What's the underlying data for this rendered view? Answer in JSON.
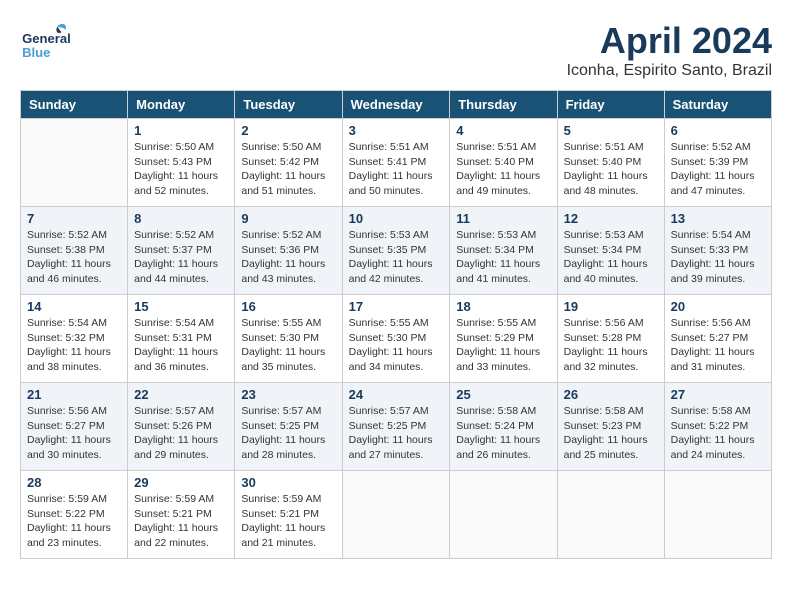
{
  "header": {
    "logo_general": "General",
    "logo_blue": "Blue",
    "month_title": "April 2024",
    "location": "Iconha, Espirito Santo, Brazil"
  },
  "days_of_week": [
    "Sunday",
    "Monday",
    "Tuesday",
    "Wednesday",
    "Thursday",
    "Friday",
    "Saturday"
  ],
  "weeks": [
    [
      {
        "day": "",
        "info": ""
      },
      {
        "day": "1",
        "info": "Sunrise: 5:50 AM\nSunset: 5:43 PM\nDaylight: 11 hours\nand 52 minutes."
      },
      {
        "day": "2",
        "info": "Sunrise: 5:50 AM\nSunset: 5:42 PM\nDaylight: 11 hours\nand 51 minutes."
      },
      {
        "day": "3",
        "info": "Sunrise: 5:51 AM\nSunset: 5:41 PM\nDaylight: 11 hours\nand 50 minutes."
      },
      {
        "day": "4",
        "info": "Sunrise: 5:51 AM\nSunset: 5:40 PM\nDaylight: 11 hours\nand 49 minutes."
      },
      {
        "day": "5",
        "info": "Sunrise: 5:51 AM\nSunset: 5:40 PM\nDaylight: 11 hours\nand 48 minutes."
      },
      {
        "day": "6",
        "info": "Sunrise: 5:52 AM\nSunset: 5:39 PM\nDaylight: 11 hours\nand 47 minutes."
      }
    ],
    [
      {
        "day": "7",
        "info": "Sunrise: 5:52 AM\nSunset: 5:38 PM\nDaylight: 11 hours\nand 46 minutes."
      },
      {
        "day": "8",
        "info": "Sunrise: 5:52 AM\nSunset: 5:37 PM\nDaylight: 11 hours\nand 44 minutes."
      },
      {
        "day": "9",
        "info": "Sunrise: 5:52 AM\nSunset: 5:36 PM\nDaylight: 11 hours\nand 43 minutes."
      },
      {
        "day": "10",
        "info": "Sunrise: 5:53 AM\nSunset: 5:35 PM\nDaylight: 11 hours\nand 42 minutes."
      },
      {
        "day": "11",
        "info": "Sunrise: 5:53 AM\nSunset: 5:34 PM\nDaylight: 11 hours\nand 41 minutes."
      },
      {
        "day": "12",
        "info": "Sunrise: 5:53 AM\nSunset: 5:34 PM\nDaylight: 11 hours\nand 40 minutes."
      },
      {
        "day": "13",
        "info": "Sunrise: 5:54 AM\nSunset: 5:33 PM\nDaylight: 11 hours\nand 39 minutes."
      }
    ],
    [
      {
        "day": "14",
        "info": "Sunrise: 5:54 AM\nSunset: 5:32 PM\nDaylight: 11 hours\nand 38 minutes."
      },
      {
        "day": "15",
        "info": "Sunrise: 5:54 AM\nSunset: 5:31 PM\nDaylight: 11 hours\nand 36 minutes."
      },
      {
        "day": "16",
        "info": "Sunrise: 5:55 AM\nSunset: 5:30 PM\nDaylight: 11 hours\nand 35 minutes."
      },
      {
        "day": "17",
        "info": "Sunrise: 5:55 AM\nSunset: 5:30 PM\nDaylight: 11 hours\nand 34 minutes."
      },
      {
        "day": "18",
        "info": "Sunrise: 5:55 AM\nSunset: 5:29 PM\nDaylight: 11 hours\nand 33 minutes."
      },
      {
        "day": "19",
        "info": "Sunrise: 5:56 AM\nSunset: 5:28 PM\nDaylight: 11 hours\nand 32 minutes."
      },
      {
        "day": "20",
        "info": "Sunrise: 5:56 AM\nSunset: 5:27 PM\nDaylight: 11 hours\nand 31 minutes."
      }
    ],
    [
      {
        "day": "21",
        "info": "Sunrise: 5:56 AM\nSunset: 5:27 PM\nDaylight: 11 hours\nand 30 minutes."
      },
      {
        "day": "22",
        "info": "Sunrise: 5:57 AM\nSunset: 5:26 PM\nDaylight: 11 hours\nand 29 minutes."
      },
      {
        "day": "23",
        "info": "Sunrise: 5:57 AM\nSunset: 5:25 PM\nDaylight: 11 hours\nand 28 minutes."
      },
      {
        "day": "24",
        "info": "Sunrise: 5:57 AM\nSunset: 5:25 PM\nDaylight: 11 hours\nand 27 minutes."
      },
      {
        "day": "25",
        "info": "Sunrise: 5:58 AM\nSunset: 5:24 PM\nDaylight: 11 hours\nand 26 minutes."
      },
      {
        "day": "26",
        "info": "Sunrise: 5:58 AM\nSunset: 5:23 PM\nDaylight: 11 hours\nand 25 minutes."
      },
      {
        "day": "27",
        "info": "Sunrise: 5:58 AM\nSunset: 5:22 PM\nDaylight: 11 hours\nand 24 minutes."
      }
    ],
    [
      {
        "day": "28",
        "info": "Sunrise: 5:59 AM\nSunset: 5:22 PM\nDaylight: 11 hours\nand 23 minutes."
      },
      {
        "day": "29",
        "info": "Sunrise: 5:59 AM\nSunset: 5:21 PM\nDaylight: 11 hours\nand 22 minutes."
      },
      {
        "day": "30",
        "info": "Sunrise: 5:59 AM\nSunset: 5:21 PM\nDaylight: 11 hours\nand 21 minutes."
      },
      {
        "day": "",
        "info": ""
      },
      {
        "day": "",
        "info": ""
      },
      {
        "day": "",
        "info": ""
      },
      {
        "day": "",
        "info": ""
      }
    ]
  ]
}
